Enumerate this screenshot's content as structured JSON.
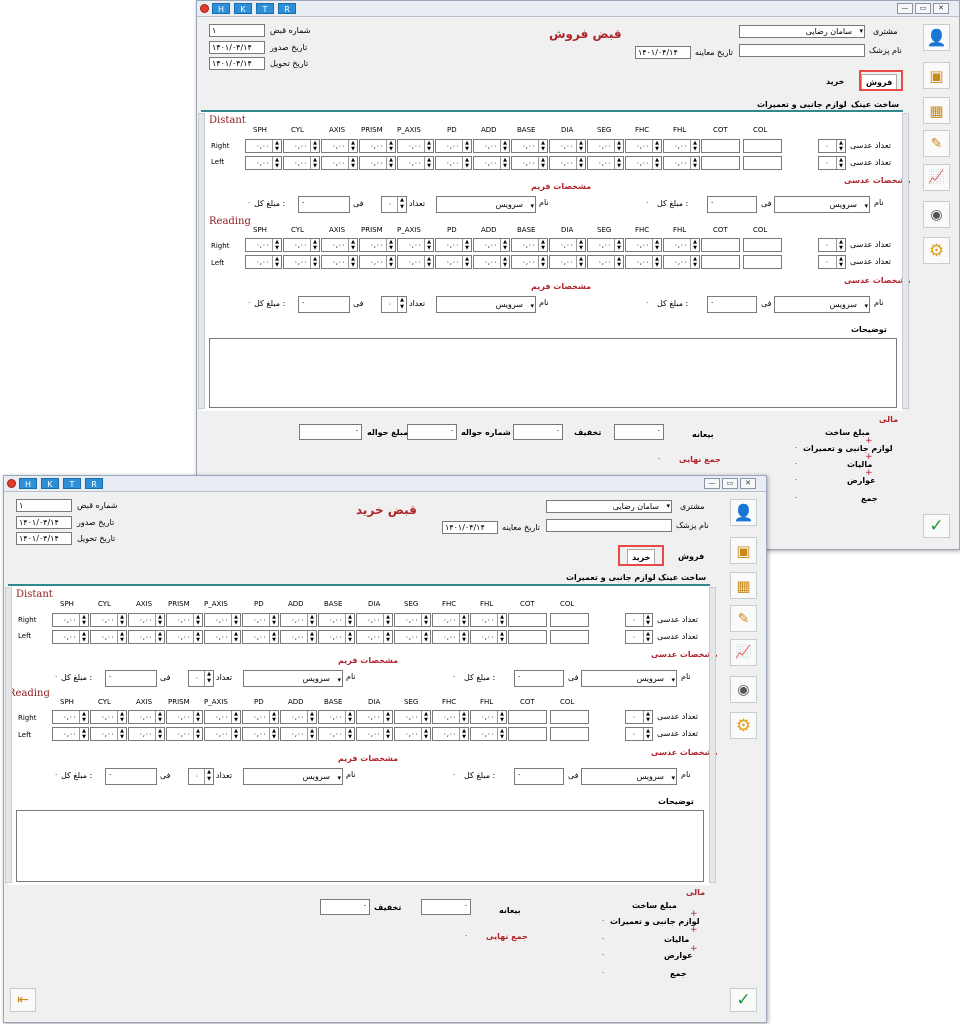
{
  "common": {
    "hktr": [
      "H",
      "K",
      "T",
      "R"
    ],
    "receipt_no_label": "شماره قبض",
    "receipt_no_value": "۱",
    "issue_date_label": "تاریخ صدور",
    "issue_date_value": "۱۴۰۱/۰۴/۱۴",
    "delivery_date_label": "تاریخ تحویل",
    "delivery_date_value": "۱۴۰۱/۰۴/۱۴",
    "customer_label": "مشتری",
    "customer_value": "سامان رضایی",
    "doctor_label": "نام پزشک",
    "exam_date_label": "تاریخ معاینه",
    "exam_date_value": "۱۴۰۱/۰۴/۱۴",
    "tab_sale": "فروش",
    "tab_purchase": "خرید",
    "subtab_build": "ساخت عینک",
    "subtab_accessories": "لوازم جانبی و تعمیرات",
    "distant": "Distant",
    "reading": "Reading",
    "columns": [
      "SPH",
      "CYL",
      "AXIS",
      "PRISM",
      "P_AXIS",
      "PD",
      "ADD",
      "BASE",
      "DIA",
      "SEG",
      "FHC",
      "FHL",
      "COT",
      "COL"
    ],
    "right": "Right",
    "left": "Left",
    "spin_value": "۰,۰۰",
    "lens_count_label": "تعداد عدسی",
    "lens_count_value": "۰",
    "lens_specs": "مشخصات عدسی",
    "frame_specs": "مشخصات فریم",
    "name_label": "نام",
    "service": "سرویس",
    "fee_label": "فی",
    "total_label": "مبلغ کل :",
    "zero": "۰",
    "count_label": "تعداد",
    "notes_label": "توضیحات",
    "financial": "مالی",
    "build_amount": "مبلغ ساخت",
    "accessories_amount": "لوازم جانبی و تعمیرات",
    "taxes": "مالیات",
    "duties": "عوارض",
    "sum": "جمع",
    "deposit": "بیعانه",
    "discount": "تخفیف",
    "remittance_no": "شماره حواله",
    "remittance_amount": "مبلغ حواله",
    "final_total": "جمع نهایی",
    "plus": "+",
    "colon": ":",
    "check": "✓"
  },
  "back": {
    "title": "قبض فروش"
  },
  "front": {
    "title": "قبض خرید"
  }
}
